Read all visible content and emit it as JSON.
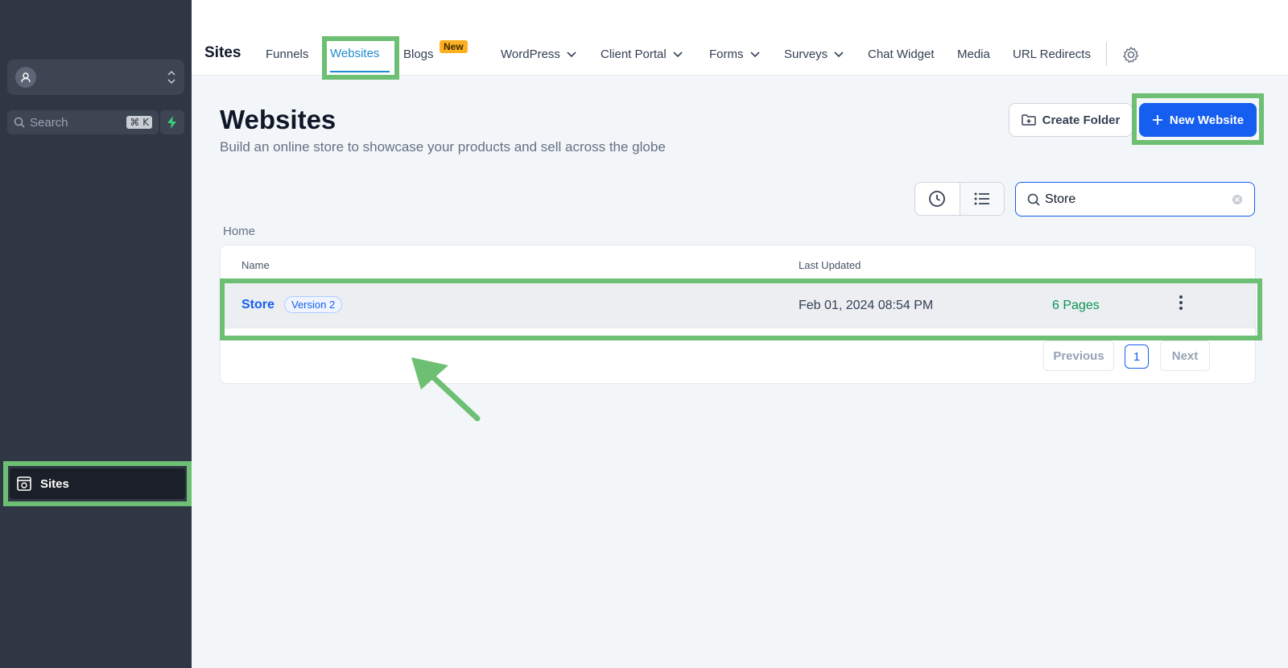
{
  "sidebar": {
    "search_placeholder": "Search",
    "search_shortcut": "⌘ K",
    "items": [
      {
        "label": "Sites"
      }
    ]
  },
  "topnav": {
    "brand": "Sites",
    "items": [
      {
        "label": "Funnels"
      },
      {
        "label": "Websites"
      },
      {
        "label": "Blogs",
        "badge": "New"
      },
      {
        "label": "WordPress"
      },
      {
        "label": "Client Portal"
      },
      {
        "label": "Forms"
      },
      {
        "label": "Surveys"
      },
      {
        "label": "Chat Widget"
      },
      {
        "label": "Media"
      },
      {
        "label": "URL Redirects"
      }
    ]
  },
  "main": {
    "title": "Websites",
    "subtitle": "Build an online store to showcase your products and sell across the globe",
    "create_folder_label": "Create Folder",
    "new_website_label": "New Website",
    "search_value": "Store",
    "breadcrumb": "Home",
    "table": {
      "headers": {
        "name": "Name",
        "last_updated": "Last Updated"
      },
      "rows": [
        {
          "name": "Store",
          "version": "Version 2",
          "updated": "Feb 01, 2024 08:54 PM",
          "pages": "6 Pages"
        }
      ]
    },
    "pagination": {
      "previous": "Previous",
      "current": "1",
      "next": "Next"
    }
  },
  "colors": {
    "accent": "#155eef",
    "active_tab": "#1f8ccf",
    "sidebar": "#2f3745",
    "highlight": "#6dbf73",
    "success": "#079455"
  }
}
